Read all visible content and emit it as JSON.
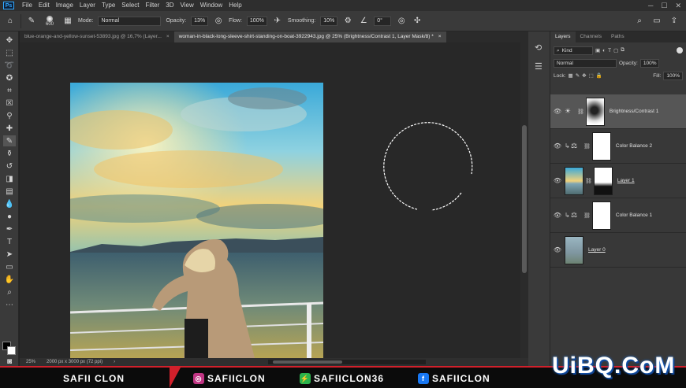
{
  "app": {
    "logo": "Ps"
  },
  "menu": [
    "File",
    "Edit",
    "Image",
    "Layer",
    "Type",
    "Select",
    "Filter",
    "3D",
    "View",
    "Window",
    "Help"
  ],
  "options": {
    "brush_size": "600",
    "mode_label": "Mode:",
    "mode_value": "Normal",
    "opacity_label": "Opacity:",
    "opacity_value": "13%",
    "flow_label": "Flow:",
    "flow_value": "100%",
    "smoothing_label": "Smoothing:",
    "smoothing_value": "10%",
    "angle_value": "0°"
  },
  "tabs": [
    {
      "title": "blue-orange-and-yellow-sunset-53893.jpg @ 16,7% (Layer...",
      "close": "×"
    },
    {
      "title": "woman-in-black-long-sleeve-shirt-standing-on-boat-3922943.jpg @ 25% (Brightness/Contrast 1, Layer Mask/8) *",
      "close": "×"
    }
  ],
  "status": {
    "zoom": "25%",
    "doc_size": "2000 px x 3000 px (72 ppi)"
  },
  "layers_panel": {
    "tabs": [
      "Layers",
      "Channels",
      "Paths"
    ],
    "filter_kind": "Kind",
    "blend_mode": "Normal",
    "opacity_label": "Opacity:",
    "opacity_value": "100%",
    "lock_label": "Lock:",
    "fill_label": "Fill:",
    "fill_value": "100%",
    "layers": [
      {
        "name": "Brightness/Contrast 1",
        "selected": true
      },
      {
        "name": "Color Balance 2",
        "selected": false
      },
      {
        "name": "Layer 1",
        "selected": false
      },
      {
        "name": "Color Balance 1",
        "selected": false
      },
      {
        "name": "Layer 0",
        "selected": false
      }
    ]
  },
  "banner": {
    "name": "SAFII CLON",
    "instagram": "SAFIICLON",
    "other": "SAFIICLON36",
    "facebook": "SAFIICLON"
  },
  "watermark": "UiBQ.CoM",
  "colors": {
    "accent": "#31a8ff",
    "banner_red": "#d1202b",
    "instagram": "#c13584",
    "facebook": "#1877f2",
    "green": "#2bb24c"
  }
}
